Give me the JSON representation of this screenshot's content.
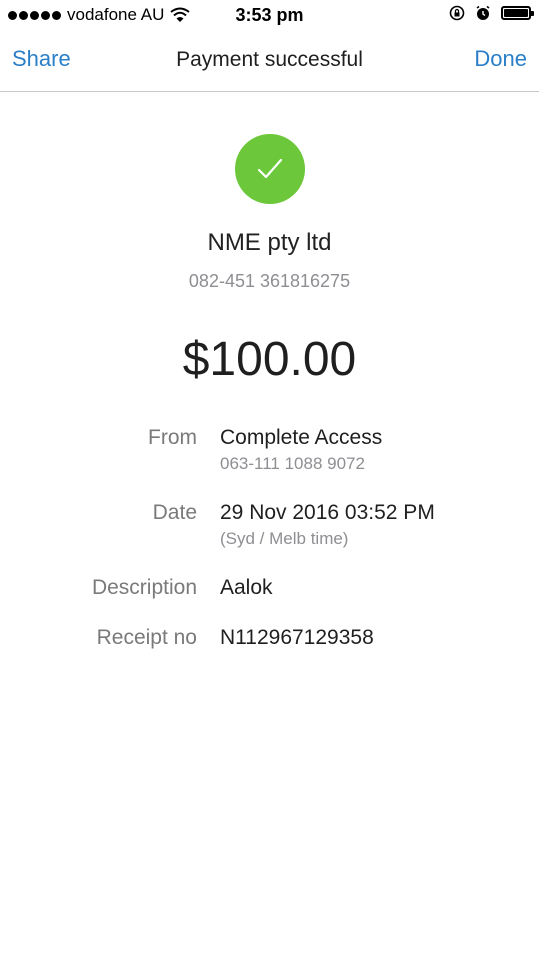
{
  "status_bar": {
    "carrier": "vodafone AU",
    "time": "3:53 pm",
    "signal_icon": "signal-dots-icon",
    "wifi_icon": "wifi-icon",
    "rotation_lock_icon": "rotation-lock-icon",
    "alarm_icon": "alarm-icon",
    "battery_icon": "battery-icon"
  },
  "nav": {
    "share_label": "Share",
    "title": "Payment successful",
    "done_label": "Done"
  },
  "success": {
    "icon": "checkmark-icon",
    "color": "#6cc83a"
  },
  "payee": {
    "name": "NME pty ltd",
    "account": "082-451 361816275"
  },
  "amount": "$100.00",
  "details": {
    "from_label": "From",
    "from_value": "Complete Access",
    "from_account": "063-111 1088 9072",
    "date_label": "Date",
    "date_value": "29 Nov 2016 03:52 PM",
    "date_note": "(Syd / Melb time)",
    "description_label": "Description",
    "description_value": "Aalok",
    "receipt_label": "Receipt no",
    "receipt_value": "N112967129358"
  },
  "colors": {
    "accent": "#2b7fc8",
    "success": "#6cc83a"
  }
}
